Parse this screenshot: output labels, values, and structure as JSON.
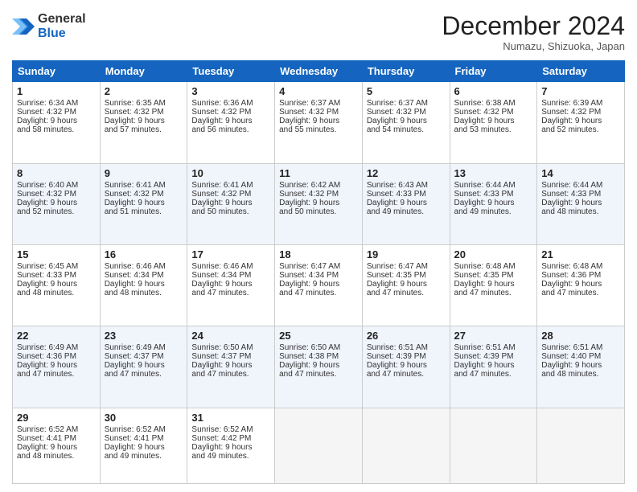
{
  "logo": {
    "general": "General",
    "blue": "Blue"
  },
  "header": {
    "month": "December 2024",
    "location": "Numazu, Shizuoka, Japan"
  },
  "days_of_week": [
    "Sunday",
    "Monday",
    "Tuesday",
    "Wednesday",
    "Thursday",
    "Friday",
    "Saturday"
  ],
  "weeks": [
    [
      {
        "day": "1",
        "lines": [
          "Sunrise: 6:34 AM",
          "Sunset: 4:32 PM",
          "Daylight: 9 hours",
          "and 58 minutes."
        ]
      },
      {
        "day": "2",
        "lines": [
          "Sunrise: 6:35 AM",
          "Sunset: 4:32 PM",
          "Daylight: 9 hours",
          "and 57 minutes."
        ]
      },
      {
        "day": "3",
        "lines": [
          "Sunrise: 6:36 AM",
          "Sunset: 4:32 PM",
          "Daylight: 9 hours",
          "and 56 minutes."
        ]
      },
      {
        "day": "4",
        "lines": [
          "Sunrise: 6:37 AM",
          "Sunset: 4:32 PM",
          "Daylight: 9 hours",
          "and 55 minutes."
        ]
      },
      {
        "day": "5",
        "lines": [
          "Sunrise: 6:37 AM",
          "Sunset: 4:32 PM",
          "Daylight: 9 hours",
          "and 54 minutes."
        ]
      },
      {
        "day": "6",
        "lines": [
          "Sunrise: 6:38 AM",
          "Sunset: 4:32 PM",
          "Daylight: 9 hours",
          "and 53 minutes."
        ]
      },
      {
        "day": "7",
        "lines": [
          "Sunrise: 6:39 AM",
          "Sunset: 4:32 PM",
          "Daylight: 9 hours",
          "and 52 minutes."
        ]
      }
    ],
    [
      {
        "day": "8",
        "lines": [
          "Sunrise: 6:40 AM",
          "Sunset: 4:32 PM",
          "Daylight: 9 hours",
          "and 52 minutes."
        ]
      },
      {
        "day": "9",
        "lines": [
          "Sunrise: 6:41 AM",
          "Sunset: 4:32 PM",
          "Daylight: 9 hours",
          "and 51 minutes."
        ]
      },
      {
        "day": "10",
        "lines": [
          "Sunrise: 6:41 AM",
          "Sunset: 4:32 PM",
          "Daylight: 9 hours",
          "and 50 minutes."
        ]
      },
      {
        "day": "11",
        "lines": [
          "Sunrise: 6:42 AM",
          "Sunset: 4:32 PM",
          "Daylight: 9 hours",
          "and 50 minutes."
        ]
      },
      {
        "day": "12",
        "lines": [
          "Sunrise: 6:43 AM",
          "Sunset: 4:33 PM",
          "Daylight: 9 hours",
          "and 49 minutes."
        ]
      },
      {
        "day": "13",
        "lines": [
          "Sunrise: 6:44 AM",
          "Sunset: 4:33 PM",
          "Daylight: 9 hours",
          "and 49 minutes."
        ]
      },
      {
        "day": "14",
        "lines": [
          "Sunrise: 6:44 AM",
          "Sunset: 4:33 PM",
          "Daylight: 9 hours",
          "and 48 minutes."
        ]
      }
    ],
    [
      {
        "day": "15",
        "lines": [
          "Sunrise: 6:45 AM",
          "Sunset: 4:33 PM",
          "Daylight: 9 hours",
          "and 48 minutes."
        ]
      },
      {
        "day": "16",
        "lines": [
          "Sunrise: 6:46 AM",
          "Sunset: 4:34 PM",
          "Daylight: 9 hours",
          "and 48 minutes."
        ]
      },
      {
        "day": "17",
        "lines": [
          "Sunrise: 6:46 AM",
          "Sunset: 4:34 PM",
          "Daylight: 9 hours",
          "and 47 minutes."
        ]
      },
      {
        "day": "18",
        "lines": [
          "Sunrise: 6:47 AM",
          "Sunset: 4:34 PM",
          "Daylight: 9 hours",
          "and 47 minutes."
        ]
      },
      {
        "day": "19",
        "lines": [
          "Sunrise: 6:47 AM",
          "Sunset: 4:35 PM",
          "Daylight: 9 hours",
          "and 47 minutes."
        ]
      },
      {
        "day": "20",
        "lines": [
          "Sunrise: 6:48 AM",
          "Sunset: 4:35 PM",
          "Daylight: 9 hours",
          "and 47 minutes."
        ]
      },
      {
        "day": "21",
        "lines": [
          "Sunrise: 6:48 AM",
          "Sunset: 4:36 PM",
          "Daylight: 9 hours",
          "and 47 minutes."
        ]
      }
    ],
    [
      {
        "day": "22",
        "lines": [
          "Sunrise: 6:49 AM",
          "Sunset: 4:36 PM",
          "Daylight: 9 hours",
          "and 47 minutes."
        ]
      },
      {
        "day": "23",
        "lines": [
          "Sunrise: 6:49 AM",
          "Sunset: 4:37 PM",
          "Daylight: 9 hours",
          "and 47 minutes."
        ]
      },
      {
        "day": "24",
        "lines": [
          "Sunrise: 6:50 AM",
          "Sunset: 4:37 PM",
          "Daylight: 9 hours",
          "and 47 minutes."
        ]
      },
      {
        "day": "25",
        "lines": [
          "Sunrise: 6:50 AM",
          "Sunset: 4:38 PM",
          "Daylight: 9 hours",
          "and 47 minutes."
        ]
      },
      {
        "day": "26",
        "lines": [
          "Sunrise: 6:51 AM",
          "Sunset: 4:39 PM",
          "Daylight: 9 hours",
          "and 47 minutes."
        ]
      },
      {
        "day": "27",
        "lines": [
          "Sunrise: 6:51 AM",
          "Sunset: 4:39 PM",
          "Daylight: 9 hours",
          "and 47 minutes."
        ]
      },
      {
        "day": "28",
        "lines": [
          "Sunrise: 6:51 AM",
          "Sunset: 4:40 PM",
          "Daylight: 9 hours",
          "and 48 minutes."
        ]
      }
    ],
    [
      {
        "day": "29",
        "lines": [
          "Sunrise: 6:52 AM",
          "Sunset: 4:41 PM",
          "Daylight: 9 hours",
          "and 48 minutes."
        ]
      },
      {
        "day": "30",
        "lines": [
          "Sunrise: 6:52 AM",
          "Sunset: 4:41 PM",
          "Daylight: 9 hours",
          "and 49 minutes."
        ]
      },
      {
        "day": "31",
        "lines": [
          "Sunrise: 6:52 AM",
          "Sunset: 4:42 PM",
          "Daylight: 9 hours",
          "and 49 minutes."
        ]
      },
      {
        "day": "",
        "lines": []
      },
      {
        "day": "",
        "lines": []
      },
      {
        "day": "",
        "lines": []
      },
      {
        "day": "",
        "lines": []
      }
    ]
  ]
}
